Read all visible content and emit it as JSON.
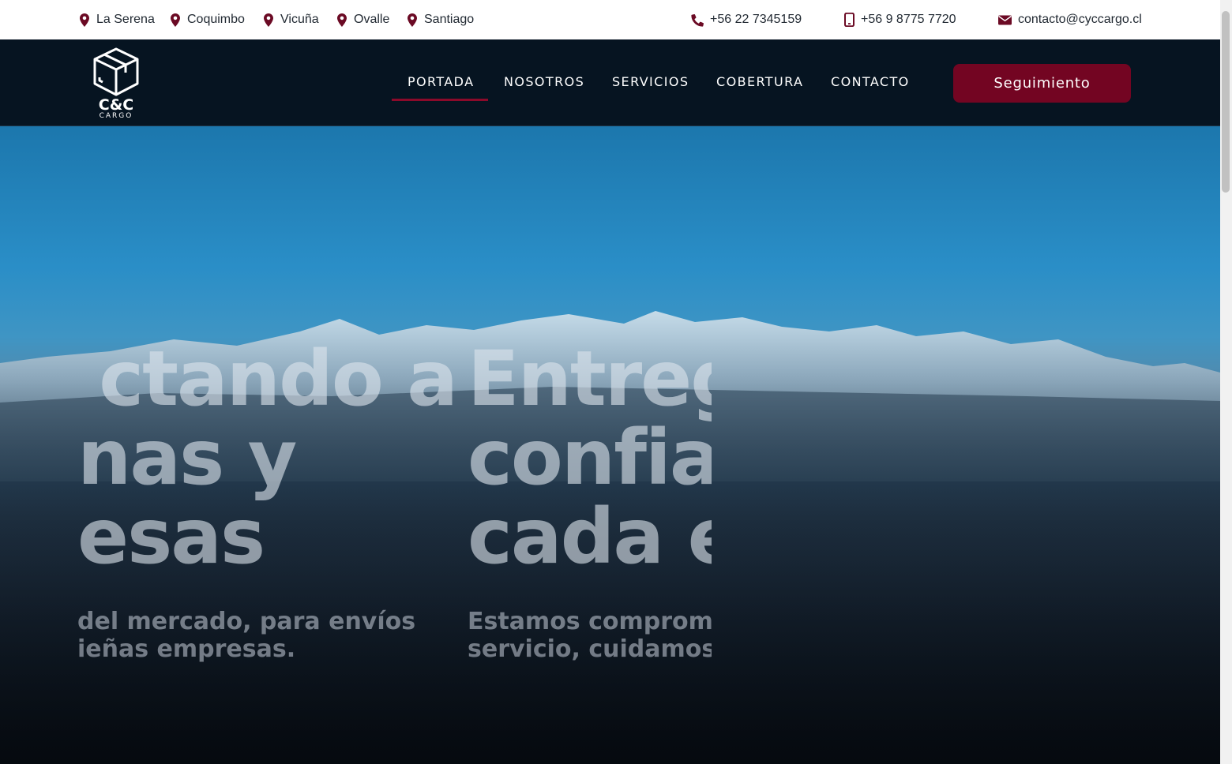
{
  "topbar": {
    "locations": [
      "La Serena",
      "Coquimbo",
      "Vicuña",
      "Ovalle",
      "Santiago"
    ],
    "phone": "+56 22 7345159",
    "mobile": "+56 9 8775 7720",
    "email": "contacto@cyccargo.cl"
  },
  "brand": {
    "name": "C&C",
    "sub": "CARGO"
  },
  "nav": {
    "items": [
      "PORTADA",
      "NOSOTROS",
      "SERVICIOS",
      "COBERTURA",
      "CONTACTO"
    ],
    "active": "PORTADA",
    "cta": "Seguimiento"
  },
  "hero": {
    "slide_prev": {
      "lines": [
        "ctando a",
        "nas y",
        "esas"
      ],
      "sub": [
        "del mercado, para envíos",
        "ieñas empresas."
      ]
    },
    "slide_next": {
      "lines": [
        "Entreg",
        "confia",
        "cada e"
      ],
      "sub": [
        "Estamos comprom",
        "servicio, cuidamos"
      ]
    }
  },
  "colors": {
    "accent": "#730522",
    "pin": "#6b0a24",
    "header_bg": "#061421"
  },
  "icons": {
    "location": "map-pin-icon",
    "phone": "phone-icon",
    "mobile": "mobile-icon",
    "email": "envelope-icon"
  }
}
